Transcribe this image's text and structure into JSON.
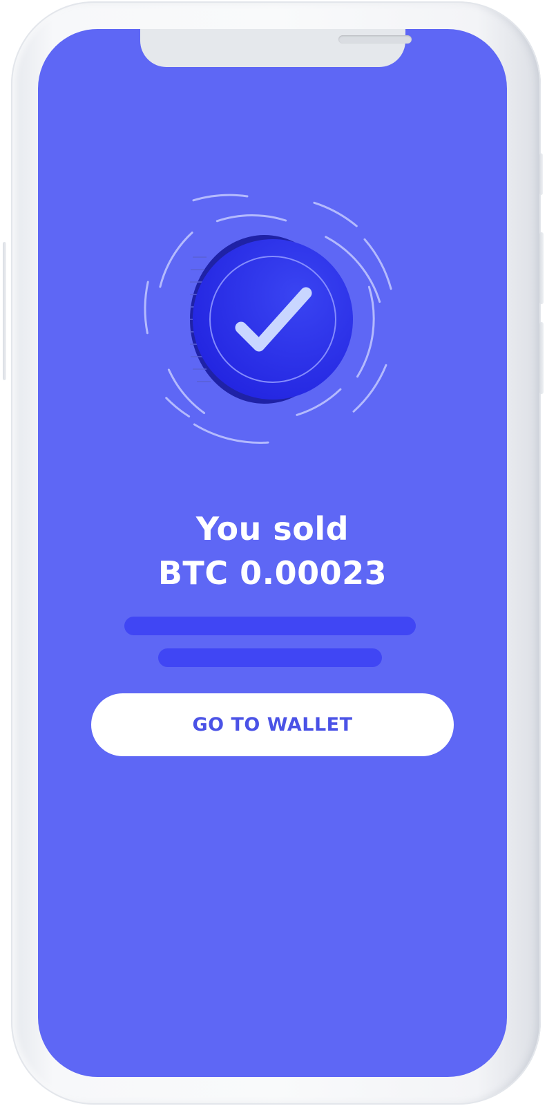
{
  "confirmation": {
    "title_line1": "You sold",
    "title_line2": "BTC 0.00023"
  },
  "actions": {
    "primary_label": "GO TO WALLET"
  },
  "colors": {
    "screen_background": "#5e67f5",
    "coin_fill": "#2e30e8",
    "placeholder_bar": "#4046f4",
    "button_background": "#ffffff",
    "button_text": "#4a52e6"
  },
  "icons": {
    "illustration": "coin-checkmark-icon"
  }
}
